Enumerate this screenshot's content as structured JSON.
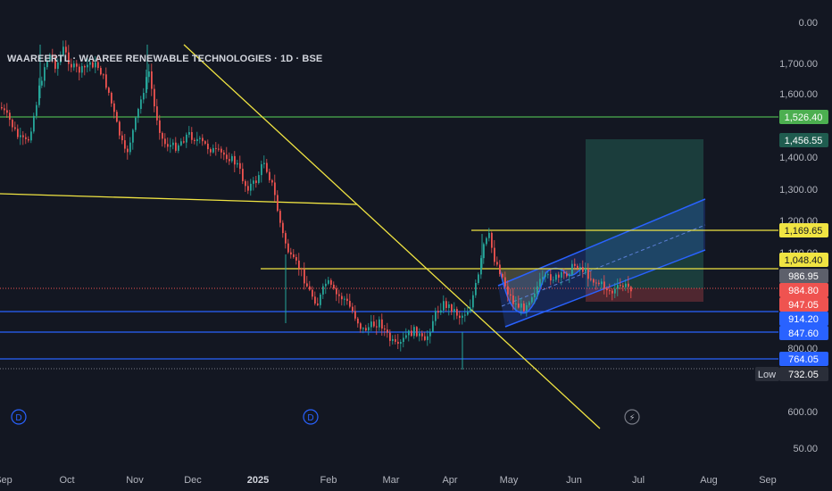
{
  "header": {
    "symbol_title": "WAAREERTL · WAAREE RENEWABLE TECHNOLOGIES · 1D · BSE"
  },
  "colors": {
    "background": "#131722",
    "up": "#26a69a",
    "down": "#ef5350",
    "trendline": "#f0e442",
    "support": "#2962ff",
    "resistance_green": "#4caf50",
    "channel": "#2962ff",
    "target_zone": "#1f4b45",
    "stop_zone": "#5b2a33"
  },
  "chart_data": {
    "type": "candlestick",
    "y_axis": {
      "scale": "log",
      "tick_labels": [
        "0.00",
        "1,700.00",
        "1,600.00",
        "1,400.00",
        "1,300.00",
        "1,200.00",
        "1,100.00",
        "800.00",
        "600.00",
        "50.00"
      ]
    },
    "x_axis": {
      "tick_labels": [
        "Sep",
        "Oct",
        "Nov",
        "Dec",
        "2025",
        "Feb",
        "Mar",
        "Apr",
        "May",
        "Jun",
        "Jul",
        "Aug",
        "Sep"
      ]
    },
    "price_levels": [
      {
        "label": "1,526.40",
        "kind": "horizontal-line",
        "color": "#4caf50"
      },
      {
        "label": "1,456.55",
        "kind": "target",
        "color": "#1f5c4f"
      },
      {
        "label": "1,169.65",
        "kind": "horizontal-line",
        "color": "#f0e442"
      },
      {
        "label": "1,048.40",
        "kind": "horizontal-line",
        "color": "#f0e442"
      },
      {
        "label": "986.95",
        "kind": "marker",
        "color": "#5d606b"
      },
      {
        "label": "984.80",
        "kind": "last-price",
        "color": "#ef5350"
      },
      {
        "label": "947.05",
        "kind": "stop",
        "color": "#ef5350"
      },
      {
        "label": "914.20",
        "kind": "horizontal-line",
        "color": "#2962ff"
      },
      {
        "label": "847.60",
        "kind": "horizontal-line",
        "color": "#2962ff"
      },
      {
        "label": "764.05",
        "kind": "horizontal-line",
        "color": "#2962ff"
      },
      {
        "label": "732.05",
        "kind": "low",
        "color": "#1e222d"
      }
    ],
    "low_tag": "Low",
    "dividend_markers": [
      "D",
      "D"
    ],
    "flash_marker": "⚡"
  }
}
